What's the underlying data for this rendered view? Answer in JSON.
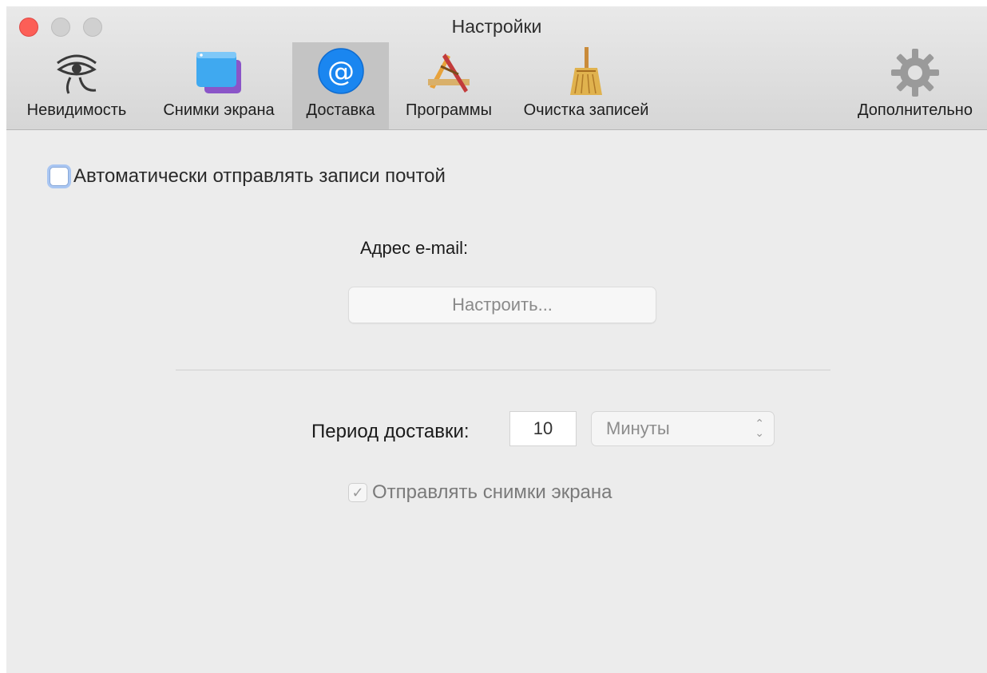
{
  "window": {
    "title": "Настройки"
  },
  "toolbar": {
    "tabs": [
      {
        "label": "Невидимость",
        "icon": "eye-of-horus-icon",
        "selected": false
      },
      {
        "label": "Снимки экрана",
        "icon": "screenshots-icon",
        "selected": false
      },
      {
        "label": "Доставка",
        "icon": "at-sign-icon",
        "selected": true
      },
      {
        "label": "Программы",
        "icon": "applications-icon",
        "selected": false
      },
      {
        "label": "Очистка записей",
        "icon": "broom-icon",
        "selected": false
      },
      {
        "label": "Дополнительно",
        "icon": "gear-icon",
        "selected": false
      }
    ]
  },
  "delivery": {
    "auto_send_label": "Автоматически отправлять записи почтой",
    "auto_send_checked": false,
    "email_label": "Адрес e-mail:",
    "configure_button": "Настроить...",
    "period_label": "Период доставки:",
    "period_value": "10",
    "period_unit": "Минуты",
    "send_screenshots_label": "Отправлять снимки экрана",
    "send_screenshots_checked": true
  },
  "colors": {
    "accent": "#1e90ff",
    "close_button": "#fc5f57"
  }
}
